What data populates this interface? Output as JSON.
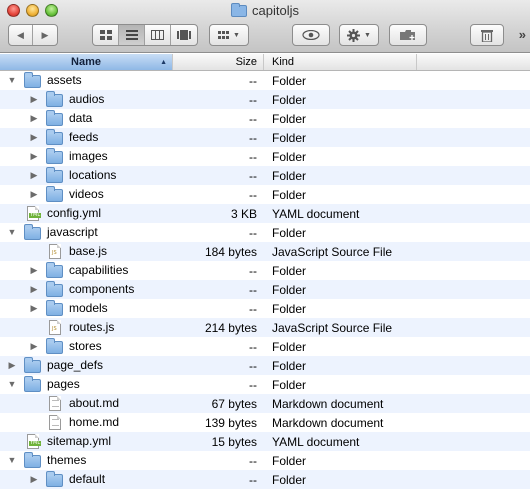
{
  "window": {
    "title": "capitoljs"
  },
  "toolbar": {
    "back_glyph": "◀",
    "forward_glyph": "▶",
    "chevron": "»",
    "buttons": [
      {
        "name": "back-forward",
        "icons": [
          "back-arrow-icon",
          "forward-arrow-icon"
        ]
      },
      {
        "name": "view-mode",
        "icons": [
          "icon-view-icon",
          "list-view-icon",
          "column-view-icon",
          "coverflow-view-icon"
        ],
        "selected": "list-view-icon"
      },
      {
        "name": "arrange",
        "icons": [
          "arrange-grid-icon"
        ]
      },
      {
        "name": "quick-look",
        "icons": [
          "eye-icon"
        ]
      },
      {
        "name": "action",
        "icons": [
          "gear-icon"
        ]
      },
      {
        "name": "new-folder",
        "icons": [
          "new-folder-icon"
        ]
      },
      {
        "name": "delete",
        "icons": [
          "trash-icon"
        ]
      }
    ]
  },
  "columns": {
    "name": "Name",
    "size": "Size",
    "kind": "Kind",
    "sorted_by": "name",
    "sort_order": "ascending"
  },
  "colors": {
    "row_alt": "#edf3fe",
    "header_selected": "#8fb8e6",
    "folder": "#7fb0e3"
  },
  "rows": [
    {
      "depth": 0,
      "disclosure": "expanded",
      "icon": "folder",
      "name": "assets",
      "size": "--",
      "kind": "Folder"
    },
    {
      "depth": 1,
      "disclosure": "collapsed",
      "icon": "folder",
      "name": "audios",
      "size": "--",
      "kind": "Folder"
    },
    {
      "depth": 1,
      "disclosure": "collapsed",
      "icon": "folder",
      "name": "data",
      "size": "--",
      "kind": "Folder"
    },
    {
      "depth": 1,
      "disclosure": "collapsed",
      "icon": "folder",
      "name": "feeds",
      "size": "--",
      "kind": "Folder"
    },
    {
      "depth": 1,
      "disclosure": "collapsed",
      "icon": "folder",
      "name": "images",
      "size": "--",
      "kind": "Folder"
    },
    {
      "depth": 1,
      "disclosure": "collapsed",
      "icon": "folder",
      "name": "locations",
      "size": "--",
      "kind": "Folder"
    },
    {
      "depth": 1,
      "disclosure": "collapsed",
      "icon": "folder",
      "name": "videos",
      "size": "--",
      "kind": "Folder"
    },
    {
      "depth": 0,
      "disclosure": "none",
      "icon": "yml",
      "name": "config.yml",
      "size": "3 KB",
      "kind": "YAML document"
    },
    {
      "depth": 0,
      "disclosure": "expanded",
      "icon": "folder",
      "name": "javascript",
      "size": "--",
      "kind": "Folder"
    },
    {
      "depth": 1,
      "disclosure": "none",
      "icon": "js",
      "name": "base.js",
      "size": "184 bytes",
      "kind": "JavaScript Source File"
    },
    {
      "depth": 1,
      "disclosure": "collapsed",
      "icon": "folder",
      "name": "capabilities",
      "size": "--",
      "kind": "Folder"
    },
    {
      "depth": 1,
      "disclosure": "collapsed",
      "icon": "folder",
      "name": "components",
      "size": "--",
      "kind": "Folder"
    },
    {
      "depth": 1,
      "disclosure": "collapsed",
      "icon": "folder",
      "name": "models",
      "size": "--",
      "kind": "Folder"
    },
    {
      "depth": 1,
      "disclosure": "none",
      "icon": "js",
      "name": "routes.js",
      "size": "214 bytes",
      "kind": "JavaScript Source File"
    },
    {
      "depth": 1,
      "disclosure": "collapsed",
      "icon": "folder",
      "name": "stores",
      "size": "--",
      "kind": "Folder"
    },
    {
      "depth": 0,
      "disclosure": "collapsed",
      "icon": "folder",
      "name": "page_defs",
      "size": "--",
      "kind": "Folder"
    },
    {
      "depth": 0,
      "disclosure": "expanded",
      "icon": "folder",
      "name": "pages",
      "size": "--",
      "kind": "Folder"
    },
    {
      "depth": 1,
      "disclosure": "none",
      "icon": "md",
      "name": "about.md",
      "size": "67 bytes",
      "kind": "Markdown document"
    },
    {
      "depth": 1,
      "disclosure": "none",
      "icon": "md",
      "name": "home.md",
      "size": "139 bytes",
      "kind": "Markdown document"
    },
    {
      "depth": 0,
      "disclosure": "none",
      "icon": "yml",
      "name": "sitemap.yml",
      "size": "15 bytes",
      "kind": "YAML document"
    },
    {
      "depth": 0,
      "disclosure": "expanded",
      "icon": "folder",
      "name": "themes",
      "size": "--",
      "kind": "Folder"
    },
    {
      "depth": 1,
      "disclosure": "collapsed",
      "icon": "folder",
      "name": "default",
      "size": "--",
      "kind": "Folder"
    }
  ]
}
